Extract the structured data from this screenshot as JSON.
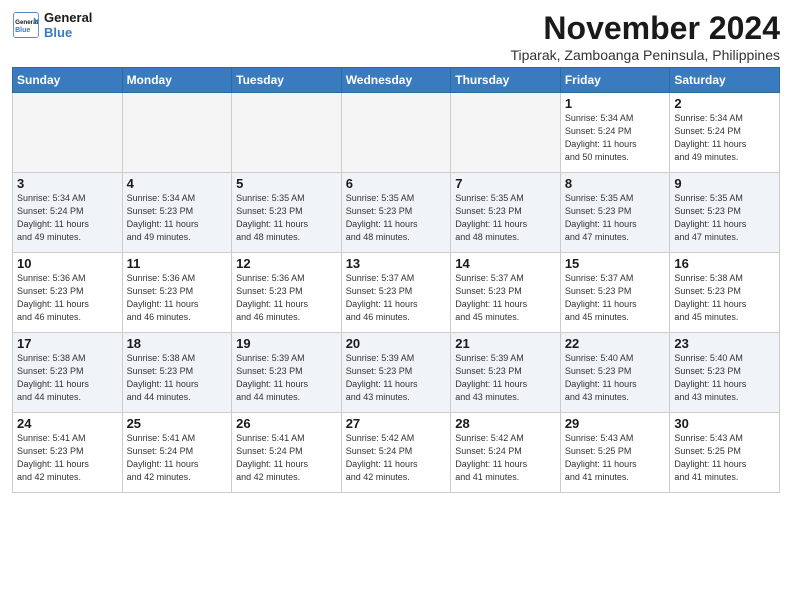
{
  "header": {
    "logo_general": "General",
    "logo_blue": "Blue",
    "month_title": "November 2024",
    "subtitle": "Tiparak, Zamboanga Peninsula, Philippines"
  },
  "days_of_week": [
    "Sunday",
    "Monday",
    "Tuesday",
    "Wednesday",
    "Thursday",
    "Friday",
    "Saturday"
  ],
  "weeks": [
    [
      {
        "num": "",
        "info": "",
        "empty": true
      },
      {
        "num": "",
        "info": "",
        "empty": true
      },
      {
        "num": "",
        "info": "",
        "empty": true
      },
      {
        "num": "",
        "info": "",
        "empty": true
      },
      {
        "num": "",
        "info": "",
        "empty": true
      },
      {
        "num": "1",
        "info": "Sunrise: 5:34 AM\nSunset: 5:24 PM\nDaylight: 11 hours\nand 50 minutes.",
        "empty": false
      },
      {
        "num": "2",
        "info": "Sunrise: 5:34 AM\nSunset: 5:24 PM\nDaylight: 11 hours\nand 49 minutes.",
        "empty": false
      }
    ],
    [
      {
        "num": "3",
        "info": "Sunrise: 5:34 AM\nSunset: 5:24 PM\nDaylight: 11 hours\nand 49 minutes.",
        "empty": false
      },
      {
        "num": "4",
        "info": "Sunrise: 5:34 AM\nSunset: 5:23 PM\nDaylight: 11 hours\nand 49 minutes.",
        "empty": false
      },
      {
        "num": "5",
        "info": "Sunrise: 5:35 AM\nSunset: 5:23 PM\nDaylight: 11 hours\nand 48 minutes.",
        "empty": false
      },
      {
        "num": "6",
        "info": "Sunrise: 5:35 AM\nSunset: 5:23 PM\nDaylight: 11 hours\nand 48 minutes.",
        "empty": false
      },
      {
        "num": "7",
        "info": "Sunrise: 5:35 AM\nSunset: 5:23 PM\nDaylight: 11 hours\nand 48 minutes.",
        "empty": false
      },
      {
        "num": "8",
        "info": "Sunrise: 5:35 AM\nSunset: 5:23 PM\nDaylight: 11 hours\nand 47 minutes.",
        "empty": false
      },
      {
        "num": "9",
        "info": "Sunrise: 5:35 AM\nSunset: 5:23 PM\nDaylight: 11 hours\nand 47 minutes.",
        "empty": false
      }
    ],
    [
      {
        "num": "10",
        "info": "Sunrise: 5:36 AM\nSunset: 5:23 PM\nDaylight: 11 hours\nand 46 minutes.",
        "empty": false
      },
      {
        "num": "11",
        "info": "Sunrise: 5:36 AM\nSunset: 5:23 PM\nDaylight: 11 hours\nand 46 minutes.",
        "empty": false
      },
      {
        "num": "12",
        "info": "Sunrise: 5:36 AM\nSunset: 5:23 PM\nDaylight: 11 hours\nand 46 minutes.",
        "empty": false
      },
      {
        "num": "13",
        "info": "Sunrise: 5:37 AM\nSunset: 5:23 PM\nDaylight: 11 hours\nand 46 minutes.",
        "empty": false
      },
      {
        "num": "14",
        "info": "Sunrise: 5:37 AM\nSunset: 5:23 PM\nDaylight: 11 hours\nand 45 minutes.",
        "empty": false
      },
      {
        "num": "15",
        "info": "Sunrise: 5:37 AM\nSunset: 5:23 PM\nDaylight: 11 hours\nand 45 minutes.",
        "empty": false
      },
      {
        "num": "16",
        "info": "Sunrise: 5:38 AM\nSunset: 5:23 PM\nDaylight: 11 hours\nand 45 minutes.",
        "empty": false
      }
    ],
    [
      {
        "num": "17",
        "info": "Sunrise: 5:38 AM\nSunset: 5:23 PM\nDaylight: 11 hours\nand 44 minutes.",
        "empty": false
      },
      {
        "num": "18",
        "info": "Sunrise: 5:38 AM\nSunset: 5:23 PM\nDaylight: 11 hours\nand 44 minutes.",
        "empty": false
      },
      {
        "num": "19",
        "info": "Sunrise: 5:39 AM\nSunset: 5:23 PM\nDaylight: 11 hours\nand 44 minutes.",
        "empty": false
      },
      {
        "num": "20",
        "info": "Sunrise: 5:39 AM\nSunset: 5:23 PM\nDaylight: 11 hours\nand 43 minutes.",
        "empty": false
      },
      {
        "num": "21",
        "info": "Sunrise: 5:39 AM\nSunset: 5:23 PM\nDaylight: 11 hours\nand 43 minutes.",
        "empty": false
      },
      {
        "num": "22",
        "info": "Sunrise: 5:40 AM\nSunset: 5:23 PM\nDaylight: 11 hours\nand 43 minutes.",
        "empty": false
      },
      {
        "num": "23",
        "info": "Sunrise: 5:40 AM\nSunset: 5:23 PM\nDaylight: 11 hours\nand 43 minutes.",
        "empty": false
      }
    ],
    [
      {
        "num": "24",
        "info": "Sunrise: 5:41 AM\nSunset: 5:23 PM\nDaylight: 11 hours\nand 42 minutes.",
        "empty": false
      },
      {
        "num": "25",
        "info": "Sunrise: 5:41 AM\nSunset: 5:24 PM\nDaylight: 11 hours\nand 42 minutes.",
        "empty": false
      },
      {
        "num": "26",
        "info": "Sunrise: 5:41 AM\nSunset: 5:24 PM\nDaylight: 11 hours\nand 42 minutes.",
        "empty": false
      },
      {
        "num": "27",
        "info": "Sunrise: 5:42 AM\nSunset: 5:24 PM\nDaylight: 11 hours\nand 42 minutes.",
        "empty": false
      },
      {
        "num": "28",
        "info": "Sunrise: 5:42 AM\nSunset: 5:24 PM\nDaylight: 11 hours\nand 41 minutes.",
        "empty": false
      },
      {
        "num": "29",
        "info": "Sunrise: 5:43 AM\nSunset: 5:25 PM\nDaylight: 11 hours\nand 41 minutes.",
        "empty": false
      },
      {
        "num": "30",
        "info": "Sunrise: 5:43 AM\nSunset: 5:25 PM\nDaylight: 11 hours\nand 41 minutes.",
        "empty": false
      }
    ]
  ]
}
